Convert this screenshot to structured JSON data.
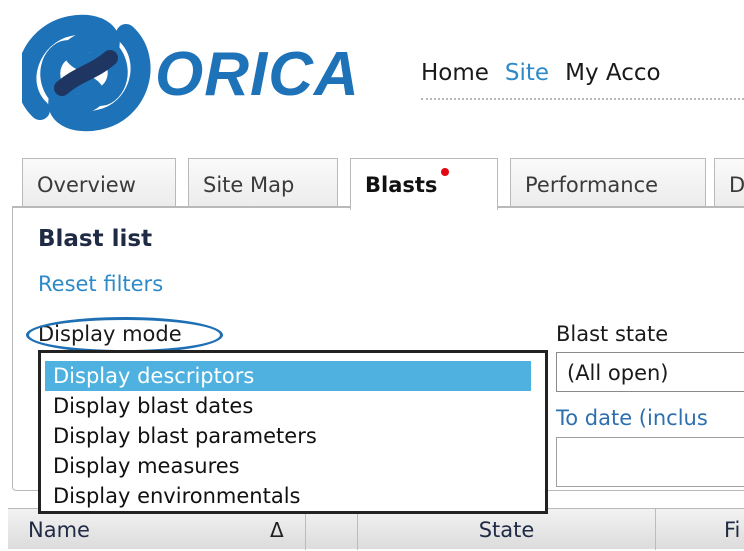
{
  "brand": {
    "name": "ORICA",
    "color": "#1e72b8"
  },
  "topnav": {
    "items": [
      "Home",
      "Site",
      "My Acco"
    ],
    "active": "Site"
  },
  "tabs": [
    "Overview",
    "Site Map",
    "Blasts",
    "Performance",
    "D"
  ],
  "active_tab": "Blasts",
  "panel": {
    "title": "Blast list",
    "reset_filters": "Reset filters",
    "display_mode_label": "Display mode",
    "display_mode_options": [
      "Display descriptors",
      "Display blast dates",
      "Display blast parameters",
      "Display measures",
      "Display environmentals"
    ],
    "display_mode_selected": "Display descriptors",
    "blast_state_label": "Blast state",
    "blast_state_value": "(All open)",
    "to_date_label": "To date (inclus",
    "to_date_value": ""
  },
  "table": {
    "columns": [
      "Name",
      "",
      "State",
      "Fi"
    ],
    "sort_indicator": "Δ"
  },
  "colors": {
    "link": "#2d8ac9",
    "selected": "#4eb1e0",
    "notify_dot": "#e30613"
  }
}
